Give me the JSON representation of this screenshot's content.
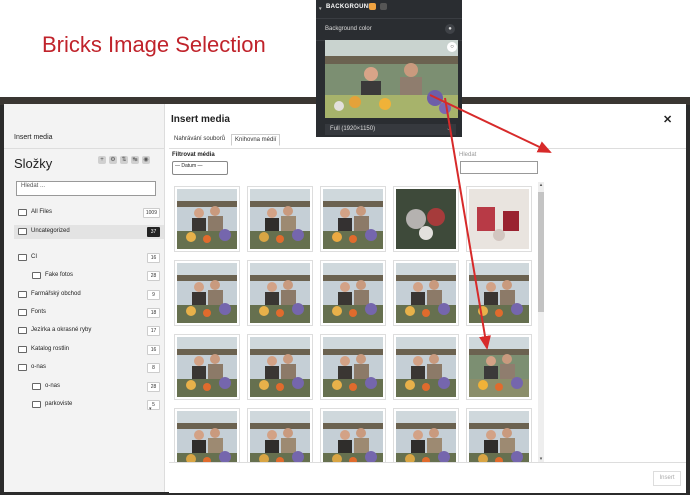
{
  "title": "Bricks Image Selection",
  "colors": {
    "accent_red": "#d72a2a",
    "title_red": "#c0232b",
    "panel_bg": "#2a2d31",
    "badge_orange": "#f0a341"
  },
  "panel": {
    "heading": "BACKGROUND",
    "background_color_label": "Background color",
    "size_select": "Full (1920×1150)"
  },
  "modal": {
    "sidebar_tab": "Insert media",
    "folders_heading": "Složky",
    "folder_search_placeholder": "Hledat ...",
    "folders": [
      {
        "label": "All Files",
        "count": "1009"
      },
      {
        "label": "Uncategorized",
        "count": "37"
      },
      {
        "label": "CI",
        "count": "16"
      },
      {
        "label": "Fake fotos",
        "count": "28"
      },
      {
        "label": "Farmářský obchod",
        "count": "9"
      },
      {
        "label": "Fonts",
        "count": "18"
      },
      {
        "label": "Jezírka a okrasné ryby",
        "count": "17"
      },
      {
        "label": "Katalog rostlin",
        "count": "16"
      },
      {
        "label": "o-nas",
        "count": "8"
      },
      {
        "label": "o-nas",
        "count": "28"
      },
      {
        "label": "parkoviste",
        "count": "5"
      }
    ],
    "heading": "Insert media",
    "tabs": [
      "Nahrávání souborů",
      "Knihovna médií"
    ],
    "filter_label": "Filtrovat média",
    "filter_select": "— Datum —",
    "search_label": "Hledat",
    "insert_button": "Insert"
  }
}
